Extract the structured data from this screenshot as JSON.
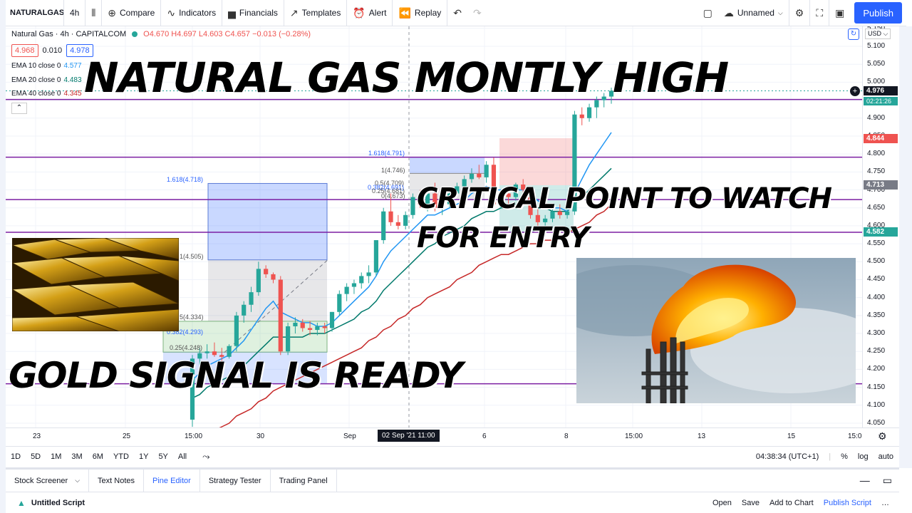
{
  "toolbar": {
    "symbol": "NATURALGAS",
    "interval": "4h",
    "compare": "Compare",
    "indicators": "Indicators",
    "financials": "Financials",
    "templates": "Templates",
    "alert": "Alert",
    "replay": "Replay",
    "layout_name": "Unnamed",
    "publish": "Publish"
  },
  "legend": {
    "title": "Natural Gas · 4h · CAPITALCOM",
    "ohlc": "O4.670 H4.697 L4.603 C4.657 −0.013 (−0.28%)",
    "bid": "4.968",
    "spread": "0.010",
    "ask": "4.978",
    "ema10_label": "EMA 10 close 0",
    "ema10_value": "4.577",
    "ema20_label": "EMA 20 close 0",
    "ema20_value": "4.483",
    "ema40_label": "EMA 40 close 0",
    "ema40_value": "4.345"
  },
  "overlays": {
    "headline": "NATURAL GAS MONTLY HIGH",
    "critical_line1": "CRITICAL POINT TO WATCH",
    "critical_line2": "FOR ENTRY",
    "gold": "GOLD SIGNAL IS READY"
  },
  "fib_left": {
    "l1618": "1.618(4.718)",
    "l1": "1(4.505)",
    "l05": "5(4.334)",
    "l0382": "0.382(4.293)",
    "l025": "0.25(4.248)"
  },
  "fib_right": {
    "l1618": "1.618(4.791)",
    "l1": "1(4.746)",
    "l05": "0.5(4.709)",
    "l0382": "0.382(4.691)",
    "l025": "0.25(4.681)",
    "l0": "0(4.673)"
  },
  "price_scale": {
    "currency": "USD",
    "ticks": [
      "5.150",
      "5.100",
      "5.050",
      "5.000",
      "4.950",
      "4.900",
      "4.850",
      "4.800",
      "4.750",
      "4.700",
      "4.650",
      "4.600",
      "4.550",
      "4.500",
      "4.450",
      "4.400",
      "4.350",
      "4.300",
      "4.250",
      "4.200",
      "4.150",
      "4.100",
      "4.050"
    ],
    "last_price": "4.976",
    "countdown": "02:21:26",
    "red_label": "4.844",
    "grey_label": "4.713",
    "green_label": "4.582"
  },
  "time_scale": {
    "labels": [
      "23",
      "25",
      "15:00",
      "30",
      "Sep",
      "6",
      "8",
      "15:00",
      "13",
      "15",
      "15:0"
    ],
    "cursor": "02 Sep '21   11:00"
  },
  "ranges": [
    "1D",
    "5D",
    "1M",
    "3M",
    "6M",
    "YTD",
    "1Y",
    "5Y",
    "All"
  ],
  "range_right": {
    "clock": "04:38:34 (UTC+1)",
    "percent": "%",
    "log": "log",
    "auto": "auto"
  },
  "bottom_tabs": [
    "Stock Screener",
    "Text Notes",
    "Pine Editor",
    "Strategy Tester",
    "Trading Panel"
  ],
  "script": {
    "name": "Untitled Script",
    "open": "Open",
    "save": "Save",
    "add": "Add to Chart",
    "publish": "Publish Script"
  },
  "colors": {
    "up": "#26a69a",
    "down": "#ef5350",
    "accent": "#2962ff",
    "level_line": "#7b1fa2"
  },
  "chart_data": {
    "type": "candlestick",
    "title": "Natural Gas · 4h · CAPITALCOM",
    "xlabel": "",
    "ylabel": "",
    "ylim": [
      4.04,
      5.16
    ],
    "candles": [
      {
        "o": 4.06,
        "h": 4.24,
        "l": 4.04,
        "c": 4.23
      },
      {
        "o": 4.23,
        "h": 4.26,
        "l": 4.2,
        "c": 4.245
      },
      {
        "o": 4.245,
        "h": 4.27,
        "l": 4.23,
        "c": 4.25
      },
      {
        "o": 4.25,
        "h": 4.275,
        "l": 4.235,
        "c": 4.24
      },
      {
        "o": 4.24,
        "h": 4.26,
        "l": 4.22,
        "c": 4.235
      },
      {
        "o": 4.235,
        "h": 4.27,
        "l": 4.23,
        "c": 4.265
      },
      {
        "o": 4.265,
        "h": 4.36,
        "l": 4.25,
        "c": 4.35
      },
      {
        "o": 4.35,
        "h": 4.39,
        "l": 4.33,
        "c": 4.38
      },
      {
        "o": 4.38,
        "h": 4.43,
        "l": 4.36,
        "c": 4.415
      },
      {
        "o": 4.415,
        "h": 4.5,
        "l": 4.405,
        "c": 4.48
      },
      {
        "o": 4.48,
        "h": 4.49,
        "l": 4.455,
        "c": 4.465
      },
      {
        "o": 4.465,
        "h": 4.47,
        "l": 4.44,
        "c": 4.45
      },
      {
        "o": 4.45,
        "h": 4.46,
        "l": 4.24,
        "c": 4.25
      },
      {
        "o": 4.25,
        "h": 4.33,
        "l": 4.24,
        "c": 4.32
      },
      {
        "o": 4.32,
        "h": 4.345,
        "l": 4.3,
        "c": 4.33
      },
      {
        "o": 4.33,
        "h": 4.34,
        "l": 4.305,
        "c": 4.315
      },
      {
        "o": 4.315,
        "h": 4.335,
        "l": 4.295,
        "c": 4.31
      },
      {
        "o": 4.31,
        "h": 4.33,
        "l": 4.295,
        "c": 4.32
      },
      {
        "o": 4.32,
        "h": 4.33,
        "l": 4.3,
        "c": 4.315
      },
      {
        "o": 4.315,
        "h": 4.36,
        "l": 4.305,
        "c": 4.36
      },
      {
        "o": 4.36,
        "h": 4.42,
        "l": 4.35,
        "c": 4.41
      },
      {
        "o": 4.41,
        "h": 4.44,
        "l": 4.39,
        "c": 4.43
      },
      {
        "o": 4.43,
        "h": 4.45,
        "l": 4.41,
        "c": 4.44
      },
      {
        "o": 4.44,
        "h": 4.47,
        "l": 4.425,
        "c": 4.46
      },
      {
        "o": 4.46,
        "h": 4.49,
        "l": 4.44,
        "c": 4.47
      },
      {
        "o": 4.47,
        "h": 4.56,
        "l": 4.46,
        "c": 4.56
      },
      {
        "o": 4.56,
        "h": 4.65,
        "l": 4.55,
        "c": 4.64
      },
      {
        "o": 4.64,
        "h": 4.69,
        "l": 4.6,
        "c": 4.61
      },
      {
        "o": 4.61,
        "h": 4.63,
        "l": 4.59,
        "c": 4.6
      },
      {
        "o": 4.6,
        "h": 4.64,
        "l": 4.59,
        "c": 4.63
      },
      {
        "o": 4.63,
        "h": 4.69,
        "l": 4.62,
        "c": 4.68
      },
      {
        "o": 4.68,
        "h": 4.7,
        "l": 4.65,
        "c": 4.66
      },
      {
        "o": 4.66,
        "h": 4.7,
        "l": 4.64,
        "c": 4.69
      },
      {
        "o": 4.69,
        "h": 4.72,
        "l": 4.64,
        "c": 4.65
      },
      {
        "o": 4.65,
        "h": 4.68,
        "l": 4.63,
        "c": 4.66
      },
      {
        "o": 4.66,
        "h": 4.7,
        "l": 4.65,
        "c": 4.69
      },
      {
        "o": 4.69,
        "h": 4.72,
        "l": 4.68,
        "c": 4.71
      },
      {
        "o": 4.71,
        "h": 4.74,
        "l": 4.7,
        "c": 4.73
      },
      {
        "o": 4.73,
        "h": 4.76,
        "l": 4.72,
        "c": 4.745
      },
      {
        "o": 4.745,
        "h": 4.77,
        "l": 4.73,
        "c": 4.735
      },
      {
        "o": 4.735,
        "h": 4.78,
        "l": 4.72,
        "c": 4.77
      },
      {
        "o": 4.77,
        "h": 4.79,
        "l": 4.65,
        "c": 4.66
      },
      {
        "o": 4.66,
        "h": 4.7,
        "l": 4.65,
        "c": 4.69
      },
      {
        "o": 4.69,
        "h": 4.71,
        "l": 4.66,
        "c": 4.68
      },
      {
        "o": 4.68,
        "h": 4.72,
        "l": 4.67,
        "c": 4.715
      },
      {
        "o": 4.715,
        "h": 4.73,
        "l": 4.68,
        "c": 4.7
      },
      {
        "o": 4.7,
        "h": 4.71,
        "l": 4.62,
        "c": 4.63
      },
      {
        "o": 4.63,
        "h": 4.65,
        "l": 4.6,
        "c": 4.61
      },
      {
        "o": 4.61,
        "h": 4.63,
        "l": 4.59,
        "c": 4.62
      },
      {
        "o": 4.62,
        "h": 4.65,
        "l": 4.61,
        "c": 4.64
      },
      {
        "o": 4.64,
        "h": 4.66,
        "l": 4.62,
        "c": 4.63
      },
      {
        "o": 4.63,
        "h": 4.65,
        "l": 4.62,
        "c": 4.64
      },
      {
        "o": 4.64,
        "h": 4.92,
        "l": 4.63,
        "c": 4.91
      },
      {
        "o": 4.91,
        "h": 4.93,
        "l": 4.88,
        "c": 4.9
      },
      {
        "o": 4.9,
        "h": 4.94,
        "l": 4.89,
        "c": 4.93
      },
      {
        "o": 4.93,
        "h": 4.96,
        "l": 4.9,
        "c": 4.95
      },
      {
        "o": 4.95,
        "h": 4.97,
        "l": 4.93,
        "c": 4.96
      },
      {
        "o": 4.96,
        "h": 4.985,
        "l": 4.94,
        "c": 4.976
      }
    ],
    "ema10": [
      4.17,
      4.19,
      4.21,
      4.22,
      4.23,
      4.24,
      4.26,
      4.28,
      4.31,
      4.34,
      4.37,
      4.39,
      4.36,
      4.35,
      4.34,
      4.33,
      4.33,
      4.32,
      4.32,
      4.33,
      4.35,
      4.37,
      4.39,
      4.41,
      4.43,
      4.46,
      4.5,
      4.53,
      4.55,
      4.57,
      4.59,
      4.61,
      4.63,
      4.63,
      4.64,
      4.65,
      4.66,
      4.67,
      4.69,
      4.7,
      4.71,
      4.7,
      4.7,
      4.7,
      4.7,
      4.7,
      4.69,
      4.67,
      4.66,
      4.65,
      4.65,
      4.64,
      4.69,
      4.73,
      4.77,
      4.8,
      4.83,
      4.86
    ],
    "ema20": [
      4.12,
      4.13,
      4.15,
      4.16,
      4.17,
      4.18,
      4.2,
      4.21,
      4.23,
      4.25,
      4.27,
      4.29,
      4.29,
      4.29,
      4.29,
      4.29,
      4.3,
      4.3,
      4.3,
      4.31,
      4.32,
      4.33,
      4.34,
      4.36,
      4.37,
      4.39,
      4.42,
      4.44,
      4.46,
      4.48,
      4.5,
      4.52,
      4.54,
      4.55,
      4.57,
      4.58,
      4.59,
      4.6,
      4.62,
      4.63,
      4.64,
      4.64,
      4.65,
      4.65,
      4.66,
      4.66,
      4.66,
      4.65,
      4.65,
      4.64,
      4.64,
      4.64,
      4.66,
      4.68,
      4.7,
      4.72,
      4.74,
      4.76
    ],
    "ema40": [
      4.0,
      4.01,
      4.02,
      4.03,
      4.04,
      4.05,
      4.07,
      4.08,
      4.09,
      4.11,
      4.12,
      4.14,
      4.15,
      4.16,
      4.17,
      4.18,
      4.19,
      4.2,
      4.21,
      4.22,
      4.23,
      4.24,
      4.25,
      4.26,
      4.28,
      4.29,
      4.31,
      4.32,
      4.34,
      4.35,
      4.37,
      4.38,
      4.4,
      4.41,
      4.42,
      4.43,
      4.45,
      4.46,
      4.47,
      4.49,
      4.5,
      4.51,
      4.52,
      4.52,
      4.53,
      4.54,
      4.55,
      4.55,
      4.56,
      4.56,
      4.57,
      4.58,
      4.59,
      4.6,
      4.61,
      4.63,
      4.64,
      4.66
    ],
    "horizontal_levels": [
      4.952,
      4.791,
      4.673,
      4.582,
      4.16
    ]
  }
}
